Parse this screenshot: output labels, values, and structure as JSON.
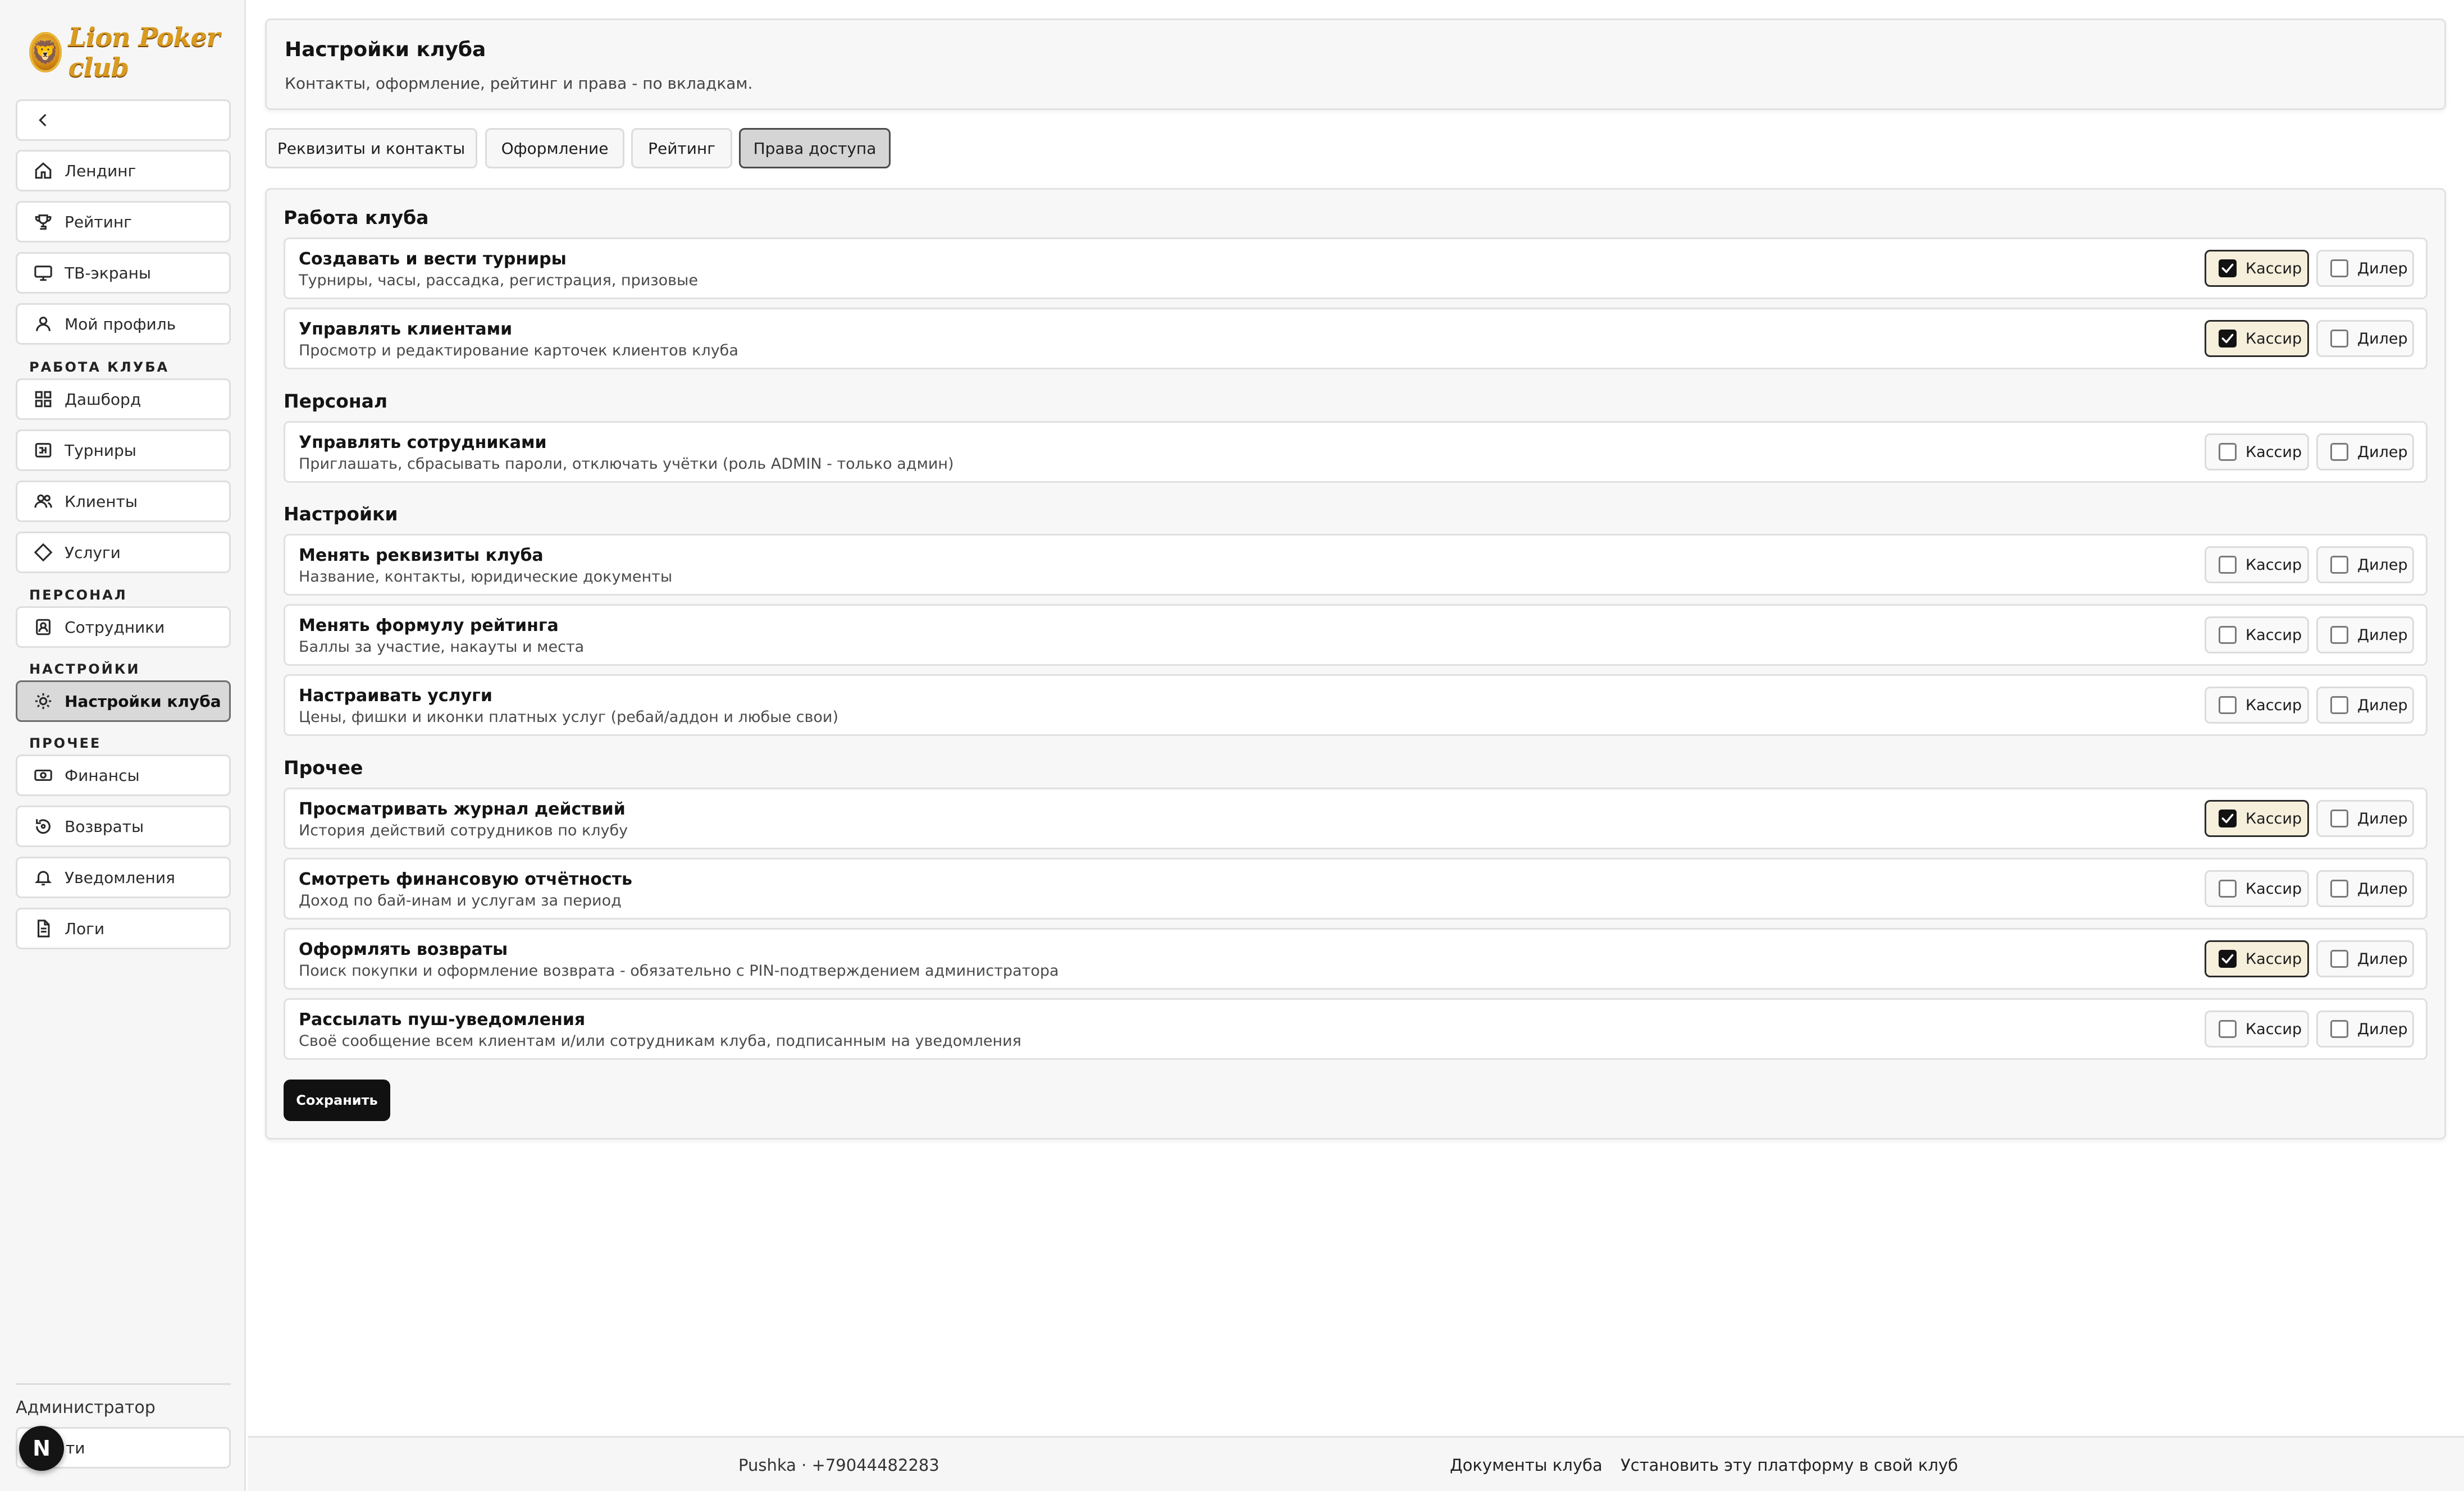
{
  "brand": {
    "logo_text": "Lion Poker club",
    "logo_glyph": "🦁"
  },
  "sidebar": {
    "back_icon": "chevron-left-icon",
    "items": [
      {
        "label": "Лендинг",
        "icon": "home-icon"
      },
      {
        "label": "Рейтинг",
        "icon": "trophy-icon"
      },
      {
        "label": "ТВ-экраны",
        "icon": "monitor-icon"
      },
      {
        "label": "Мой профиль",
        "icon": "user-icon"
      },
      {
        "label": "Дашборд",
        "icon": "grid-icon"
      },
      {
        "label": "Турниры",
        "icon": "tournament-icon"
      },
      {
        "label": "Клиенты",
        "icon": "users-icon"
      },
      {
        "label": "Услуги",
        "icon": "diamond-icon"
      },
      {
        "label": "Сотрудники",
        "icon": "badge-icon"
      },
      {
        "label": "Настройки клуба",
        "icon": "sun-gear-icon",
        "active": true
      },
      {
        "label": "Финансы",
        "icon": "cash-icon"
      },
      {
        "label": "Возвраты",
        "icon": "refund-icon"
      },
      {
        "label": "Уведомления",
        "icon": "bell-icon"
      },
      {
        "label": "Логи",
        "icon": "file-icon"
      }
    ],
    "sections": {
      "work": "РАБОТА КЛУБА",
      "staff": "ПЕРСОНАЛ",
      "settings": "НАСТРОЙКИ",
      "other": "ПРОЧЕЕ"
    },
    "role": "Администратор",
    "logout_label": "ти",
    "avatar_letter": "N"
  },
  "header": {
    "title": "Настройки клуба",
    "subtitle": "Контакты, оформление, рейтинг и права - по вкладкам."
  },
  "tabs": [
    {
      "label": "Реквизиты и контакты"
    },
    {
      "label": "Оформление"
    },
    {
      "label": "Рейтинг"
    },
    {
      "label": "Права доступа",
      "active": true
    }
  ],
  "roles": {
    "cashier": "Кассир",
    "dealer": "Дилер"
  },
  "groups": [
    {
      "title": "Работа клуба",
      "permissions": [
        {
          "title": "Создавать и вести турниры",
          "desc": "Турниры, часы, рассадка, регистрация, призовые",
          "cashier": true,
          "dealer": false
        },
        {
          "title": "Управлять клиентами",
          "desc": "Просмотр и редактирование карточек клиентов клуба",
          "cashier": true,
          "dealer": false
        }
      ]
    },
    {
      "title": "Персонал",
      "permissions": [
        {
          "title": "Управлять сотрудниками",
          "desc": "Приглашать, сбрасывать пароли, отключать учётки (роль ADMIN - только админ)",
          "cashier": false,
          "dealer": false
        }
      ]
    },
    {
      "title": "Настройки",
      "permissions": [
        {
          "title": "Менять реквизиты клуба",
          "desc": "Название, контакты, юридические документы",
          "cashier": false,
          "dealer": false
        },
        {
          "title": "Менять формулу рейтинга",
          "desc": "Баллы за участие, накауты и места",
          "cashier": false,
          "dealer": false
        },
        {
          "title": "Настраивать услуги",
          "desc": "Цены, фишки и иконки платных услуг (ребай/аддон и любые свои)",
          "cashier": false,
          "dealer": false
        }
      ]
    },
    {
      "title": "Прочее",
      "permissions": [
        {
          "title": "Просматривать журнал действий",
          "desc": "История действий сотрудников по клубу",
          "cashier": true,
          "dealer": false
        },
        {
          "title": "Смотреть финансовую отчётность",
          "desc": "Доход по бай-инам и услугам за период",
          "cashier": false,
          "dealer": false
        },
        {
          "title": "Оформлять возвраты",
          "desc": "Поиск покупки и оформление возврата - обязательно с PIN-подтверждением администратора",
          "cashier": true,
          "dealer": false
        },
        {
          "title": "Рассылать пуш-уведомления",
          "desc": "Своё сообщение всем клиентам и/или сотрудникам клуба, подписанным на уведомления",
          "cashier": false,
          "dealer": false
        }
      ]
    }
  ],
  "save_label": "Сохранить",
  "footer": {
    "contact": "Pushka · +79044482283",
    "docs_link": "Документы клуба",
    "install_link": "Установить эту платформу в свой клуб"
  },
  "colors": {
    "accent": "#111111",
    "checked_chip_bg": "#f5efdc",
    "active_nav_bg": "#d9d9d9"
  }
}
